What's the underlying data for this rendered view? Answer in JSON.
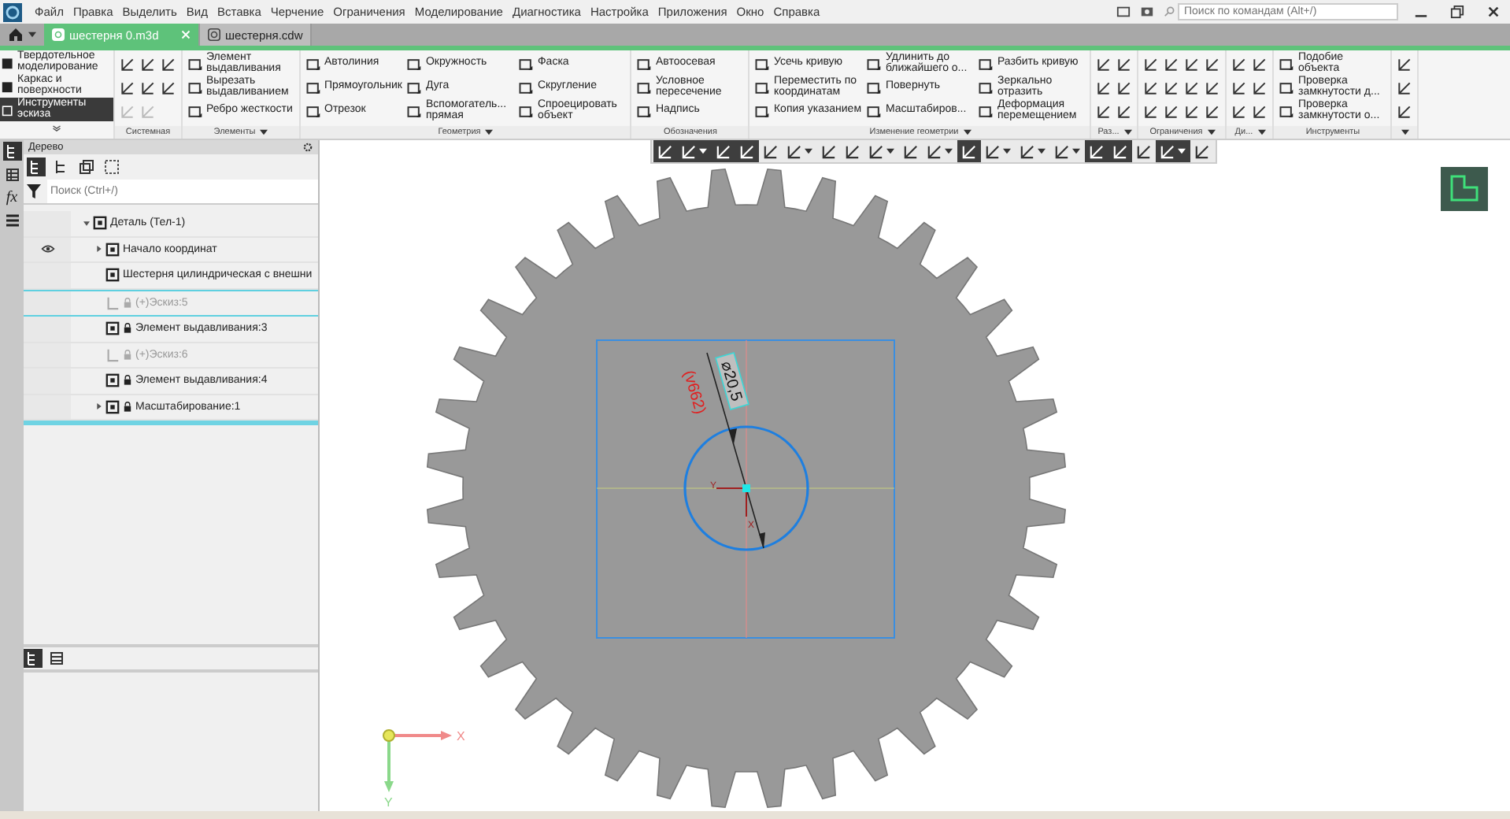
{
  "menu": {
    "items": [
      "Файл",
      "Правка",
      "Выделить",
      "Вид",
      "Вставка",
      "Черчение",
      "Ограничения",
      "Моделирование",
      "Диагностика",
      "Настройка",
      "Приложения",
      "Окно",
      "Справка"
    ]
  },
  "command_search": {
    "placeholder": "Поиск по командам (Alt+/)"
  },
  "tabs": [
    {
      "label": "шестерня 0.m3d",
      "selected": true
    },
    {
      "label": "шестерня.cdw",
      "selected": false
    }
  ],
  "ribbon": {
    "modes": [
      {
        "label": "Твердотельное моделирование",
        "selected": false
      },
      {
        "label": "Каркас и поверхности",
        "selected": false
      },
      {
        "label": "Инструменты эскиза",
        "selected": true
      }
    ],
    "groups": [
      {
        "title": "Системная",
        "buttons": [
          {
            "disabled": false
          },
          {
            "disabled": false
          },
          {
            "disabled": true
          },
          {
            "disabled": false
          },
          {
            "disabled": false
          },
          {
            "disabled": true
          },
          {
            "disabled": false
          },
          {
            "disabled": false
          }
        ]
      },
      {
        "title": "Элементы",
        "has_menu": true,
        "commands": [
          "Элемент выдавливания",
          "Вырезать выдавливанием",
          "Ребро жесткости"
        ]
      },
      {
        "title": "Геометрия",
        "has_menu": true,
        "commands": [
          "Автолиния",
          "Прямоугольник",
          "Отрезок",
          "Окружность",
          "Дуга",
          "Вспомогатель... прямая",
          "Фаска",
          "Скругление",
          "Спроецировать объект"
        ]
      },
      {
        "title": "Обозначения",
        "commands": [
          "Автоосевая",
          "Условное пересечение",
          "Надпись"
        ]
      },
      {
        "title": "Изменение геометрии",
        "has_menu": true,
        "commands": [
          "Усечь кривую",
          "Переместить по координатам",
          "Копия указанием",
          "Удлинить до ближайшего о...",
          "Повернуть",
          "Масштабиров...",
          "Разбить кривую",
          "Зеркально отразить",
          "Деформация перемещением"
        ]
      },
      {
        "title": "Раз...",
        "has_menu": true,
        "buttons": [
          {
            "disabled": false
          },
          {
            "disabled": false
          },
          {
            "disabled": false
          },
          {
            "disabled": false
          },
          {
            "disabled": false
          },
          {
            "disabled": false
          }
        ]
      },
      {
        "title": "Ограничения",
        "has_menu": true,
        "buttons": [
          {
            "disabled": false
          },
          {
            "disabled": false
          },
          {
            "disabled": false
          },
          {
            "disabled": false
          },
          {
            "disabled": false
          },
          {
            "disabled": false
          },
          {
            "disabled": false
          },
          {
            "disabled": false
          },
          {
            "disabled": false
          },
          {
            "disabled": false
          },
          {
            "disabled": false
          },
          {
            "disabled": false
          }
        ]
      },
      {
        "title": "Ди...",
        "has_menu": true,
        "buttons": [
          {
            "disabled": false
          },
          {
            "disabled": false
          },
          {
            "disabled": false
          },
          {
            "disabled": false
          },
          {
            "disabled": false
          },
          {
            "disabled": false
          }
        ]
      },
      {
        "title": "Инструменты",
        "commands": [
          "Подобие объекта",
          "Проверка замкнутости д...",
          "Проверка замкнутости о..."
        ]
      },
      {
        "has_menu": true,
        "buttons": [
          {
            "disabled": false
          },
          {
            "disabled": false
          },
          {
            "disabled": false
          }
        ]
      }
    ]
  },
  "side_strip": {
    "variables_label": "fx"
  },
  "tree_panel": {
    "title": "Дерево",
    "search_placeholder": "Поиск (Ctrl+/)",
    "tree": [
      {
        "label": "Деталь (Тел-1)",
        "expanded": true,
        "eye": false,
        "locked": false,
        "disabled": false,
        "selected": false,
        "children": [
          {
            "label": "Начало координат",
            "expanded": false,
            "eye": true,
            "locked": false,
            "disabled": false,
            "selected": false
          },
          {
            "label": "Шестерня цилиндрическая с внешни",
            "eye": false,
            "locked": false,
            "disabled": false,
            "selected": false
          },
          {
            "label": "(+)Эскиз:5",
            "eye": false,
            "locked": true,
            "disabled": true,
            "selected": true
          },
          {
            "label": "Элемент выдавливания:3",
            "eye": false,
            "locked": true,
            "disabled": false,
            "selected": false
          },
          {
            "label": "(+)Эскиз:6",
            "eye": false,
            "locked": true,
            "disabled": true,
            "selected": false
          },
          {
            "label": "Элемент выдавливания:4",
            "eye": false,
            "locked": true,
            "disabled": false,
            "selected": false
          },
          {
            "label": "Масштабирование:1",
            "expanded": false,
            "eye": false,
            "locked": true,
            "disabled": false,
            "selected": false
          }
        ]
      }
    ]
  },
  "view_toolbar": {
    "buttons": [
      {
        "on": true,
        "caret": false
      },
      {
        "on": true,
        "caret": true
      },
      {
        "on": true,
        "caret": false
      },
      {
        "on": true,
        "caret": false
      },
      {
        "on": false,
        "caret": false
      },
      {
        "on": false,
        "caret": true
      },
      {
        "on": false,
        "caret": false
      },
      {
        "on": false,
        "caret": false
      },
      {
        "on": false,
        "caret": true
      },
      {
        "on": false,
        "caret": false
      },
      {
        "on": false,
        "caret": true
      },
      {
        "on": true,
        "caret": false
      },
      {
        "on": false,
        "caret": true
      },
      {
        "on": false,
        "caret": true
      },
      {
        "on": false,
        "caret": true
      },
      {
        "on": true,
        "caret": false
      },
      {
        "on": true,
        "caret": false
      },
      {
        "on": false,
        "caret": false
      },
      {
        "on": true,
        "caret": true
      },
      {
        "on": false,
        "caret": false
      }
    ]
  },
  "sketch": {
    "dimension": "⌀20,5",
    "variable": "(v662)",
    "origin_x": "X",
    "origin_y": "Y"
  },
  "triad": {
    "x_label": "X",
    "y_label": "Y"
  }
}
